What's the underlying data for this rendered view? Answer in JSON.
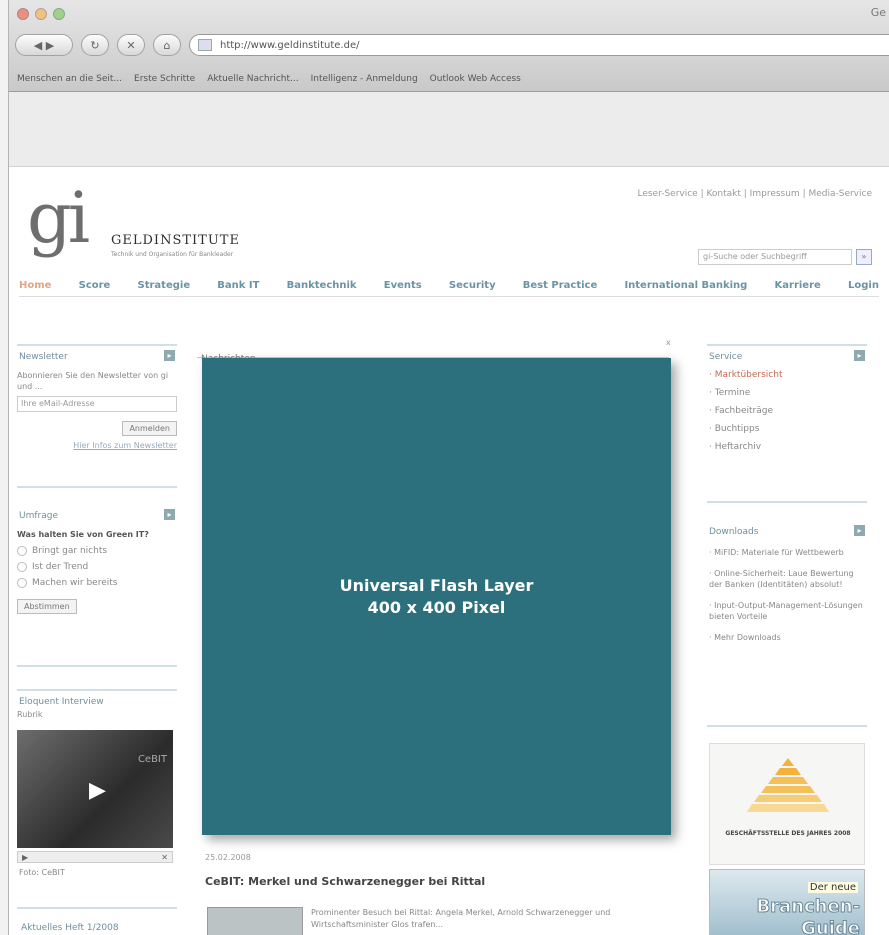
{
  "browser": {
    "window_title": "Ge",
    "url": "http://www.geldinstitute.de/",
    "bookmarks": [
      "Menschen an die Seit...",
      "Erste Schritte",
      "Aktuelle Nachricht...",
      "Intelligenz - Anmeldung",
      "Outlook Web Access"
    ]
  },
  "site": {
    "logo_letters": "gi",
    "logo_name": "GELDINSTITUTE",
    "logo_sub": "Technik und Organisation für Bankleader",
    "service_links": "Leser-Service | Kontakt | Impressum | Media-Service",
    "search_placeholder": "gi-Suche oder Suchbegriff",
    "search_button": "»",
    "nav": [
      "Home",
      "Score",
      "Strategie",
      "Bank IT",
      "Banktechnik",
      "Events",
      "Security",
      "Best Practice",
      "International Banking",
      "Karriere",
      "Login"
    ]
  },
  "left": {
    "newsletter": {
      "title": "Newsletter",
      "text": "Abonnieren Sie den Newsletter von gi und ...",
      "email_placeholder": "Ihre eMail-Adresse",
      "submit": "Anmelden",
      "link": "Hier Infos zum Newsletter"
    },
    "poll": {
      "title": "Umfrage",
      "question": "Was halten Sie von Green IT?",
      "options": [
        "Bringt gar nichts",
        "Ist der Trend",
        "Machen wir bereits"
      ],
      "vote": "Abstimmen"
    },
    "interview": {
      "title": "Eloquent Interview",
      "subtitle": "Rubrik",
      "video_caption": "CeBIT",
      "footer": "Foto: CeBIT"
    },
    "issue": {
      "title": "Aktuelles Heft 1/2008"
    }
  },
  "center": {
    "heading": "Nachrichten",
    "close": "x",
    "flash_line1": "Universal Flash Layer",
    "flash_line2": "400 x 400 Pixel",
    "news_date": "25.02.2008",
    "news_title": "CeBIT: Merkel und Schwarzenegger bei Rittal",
    "news_text": "Prominenter Besuch bei Rittal: Angela Merkel, Arnold Schwarzenegger und Wirtschaftsminister Glos trafen..."
  },
  "right": {
    "service": {
      "title": "Service",
      "items": [
        "Marktübersicht",
        "Termine",
        "Fachbeiträge",
        "Buchtipps",
        "Heftarchiv"
      ]
    },
    "downloads": {
      "title": "Downloads",
      "items": [
        "MiFID: Materiale für Wettbewerb",
        "Online-Sicherheit: Laue Bewertung der Banken (Identitäten) absolut!",
        "Input-Output-Management-Lösungen bieten Vorteile",
        "Mehr Downloads"
      ]
    },
    "ad1_label": "GESCHÄFTSSTELLE DES JAHRES 2008",
    "ad2": {
      "line1": "Der neue",
      "line2": "Branchen-",
      "line3": "Guide"
    }
  },
  "colors": {
    "flash": "#2b707c",
    "nav": "#6a94a3",
    "nav_active": "#e2a482",
    "highlight": "#c06a55"
  }
}
